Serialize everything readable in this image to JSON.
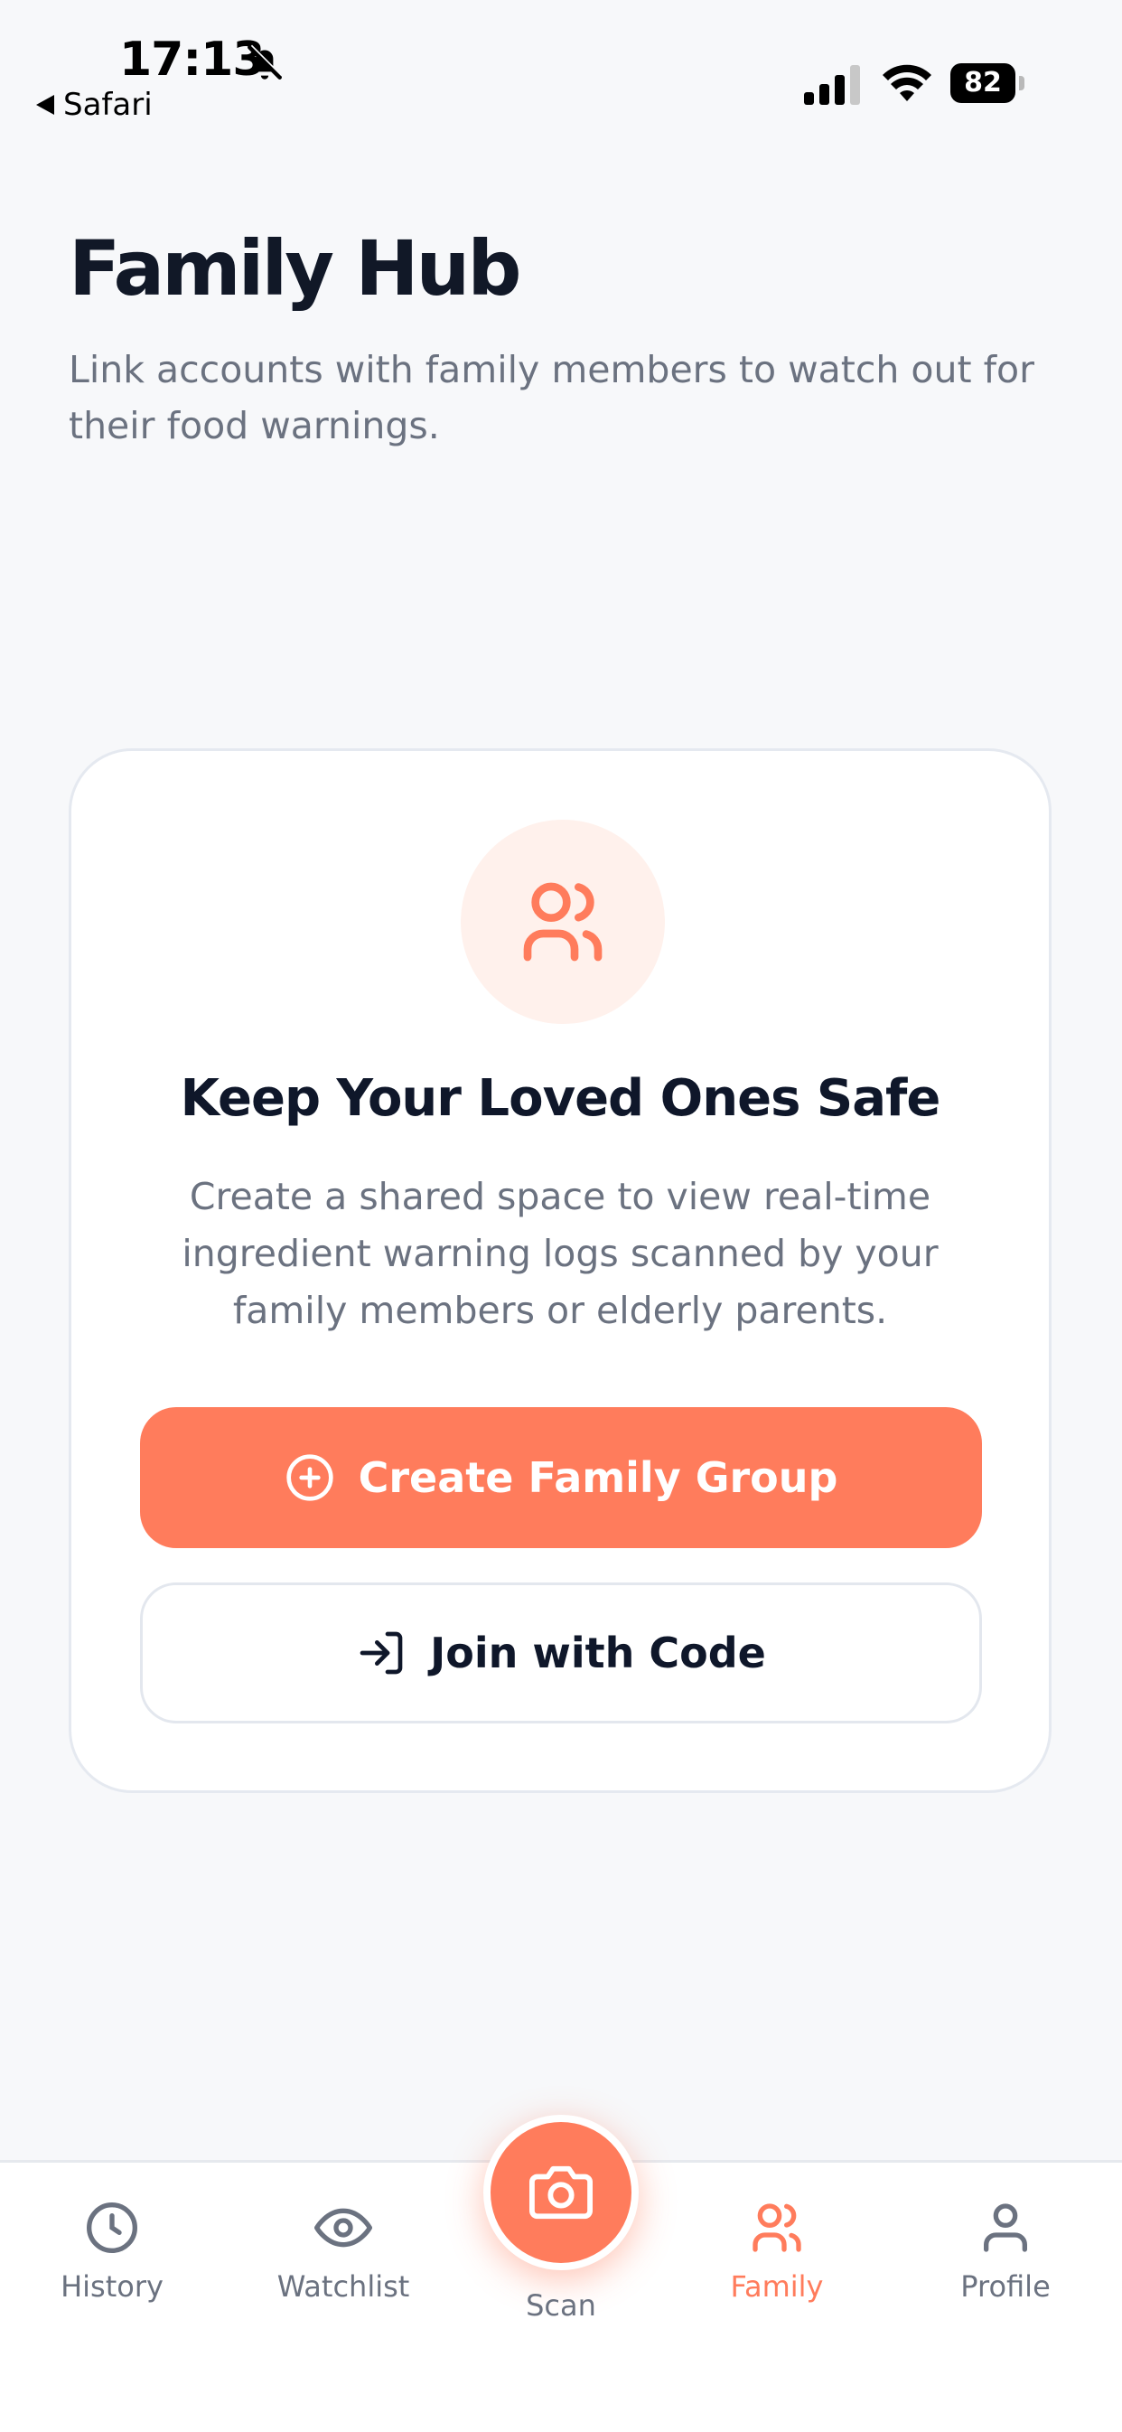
{
  "status_bar": {
    "time": "17:13",
    "back_app": "Safari",
    "battery": "82"
  },
  "header": {
    "title": "Family Hub",
    "subtitle": "Link accounts with family members to watch out for their food warnings."
  },
  "card": {
    "icon": "users-icon",
    "title": "Keep Your Loved Ones Safe",
    "description": "Create a shared space to view real-time ingredient warning logs scanned by your family members or elderly parents.",
    "primary_button": "Create Family Group",
    "secondary_button": "Join with Code"
  },
  "tab_bar": {
    "items": [
      {
        "label": "History",
        "icon": "clock-icon"
      },
      {
        "label": "Watchlist",
        "icon": "eye-icon"
      },
      {
        "label": "Scan",
        "icon": "camera-icon"
      },
      {
        "label": "Family",
        "icon": "users-icon",
        "active": true
      },
      {
        "label": "Profile",
        "icon": "user-icon"
      }
    ]
  },
  "colors": {
    "accent": "#ff7c5c",
    "accent_soft": "#fff1ec",
    "title": "#111827",
    "muted": "#6b7280"
  }
}
